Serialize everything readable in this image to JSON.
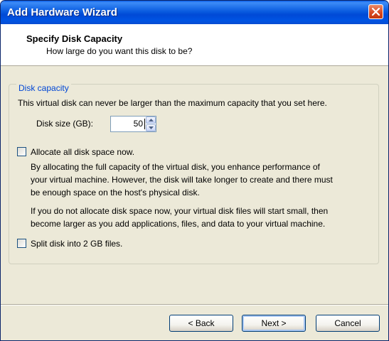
{
  "window": {
    "title": "Add Hardware Wizard",
    "colors": {
      "titlebar": "#0054e3",
      "close": "#d8461e",
      "background": "#ece9d8"
    }
  },
  "header": {
    "title": "Specify Disk Capacity",
    "subtitle": "How large do you want this disk to be?"
  },
  "disk_capacity": {
    "legend": "Disk capacity",
    "description": "This virtual disk can never be larger than the maximum capacity that you set here.",
    "size_label": "Disk size (GB):",
    "size_value": "50"
  },
  "allocate": {
    "label": "Allocate all disk space now.",
    "checked": false,
    "paragraph1": [
      "By allocating the full capacity of the virtual disk, you enhance performance of",
      "your virtual machine.  However, the disk will take longer to create and there must",
      "be enough space on the host's physical disk."
    ],
    "paragraph2": [
      "If you do not allocate disk space now, your virtual disk files will start small, then",
      "become larger as you add applications, files, and data to your virtual machine."
    ]
  },
  "split": {
    "label": "Split disk into 2 GB files.",
    "checked": false
  },
  "buttons": {
    "back": "< Back",
    "next": "Next >",
    "cancel": "Cancel"
  },
  "icons": {
    "close": "close-icon",
    "spin_up": "arrow-up-icon",
    "spin_down": "arrow-down-icon"
  }
}
